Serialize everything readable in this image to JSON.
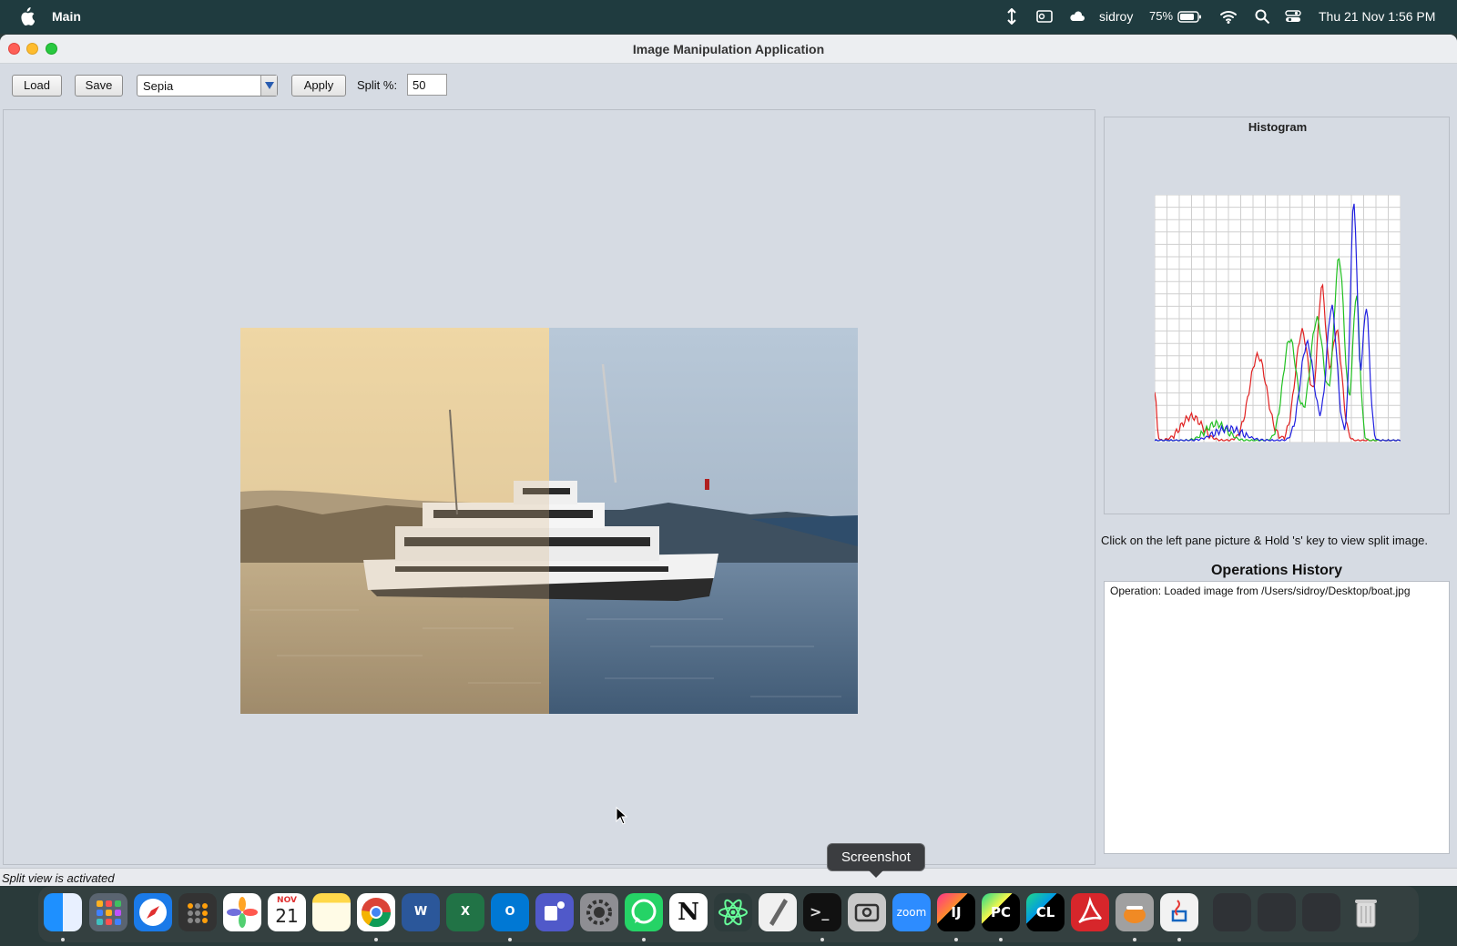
{
  "menubar": {
    "app_name": "Main",
    "user": "sidroy",
    "battery": "75%",
    "clock": "Thu 21 Nov  1:56 PM"
  },
  "window": {
    "title": "Image Manipulation Application"
  },
  "toolbar": {
    "load_label": "Load",
    "save_label": "Save",
    "operation_selected": "Sepia",
    "apply_label": "Apply",
    "split_label": "Split %:",
    "split_value": "50"
  },
  "right_panel": {
    "histogram_title": "Histogram",
    "hint": "Click on the left pane picture & Hold 's' key to view split image.",
    "ops_title": "Operations History",
    "ops_entries": [
      "Operation: Loaded image from /Users/sidroy/Desktop/boat.jpg"
    ]
  },
  "status": "Split view is activated",
  "tooltip": "Screenshot",
  "dock": {
    "calendar_month": "NOV",
    "calendar_day": "21",
    "zoom_label": "zoom",
    "intellij_label": "IJ",
    "pycharm_label": "PC",
    "clion_label": "CL",
    "word_label": "W",
    "excel_label": "X",
    "outlook_label": "O",
    "notion_label": "N"
  },
  "colors": {
    "hist_red": "#e02020",
    "hist_green": "#20c020",
    "hist_blue": "#2020e0",
    "window_bg": "#d6dbe3",
    "menubar_bg": "#1f3b3f"
  }
}
